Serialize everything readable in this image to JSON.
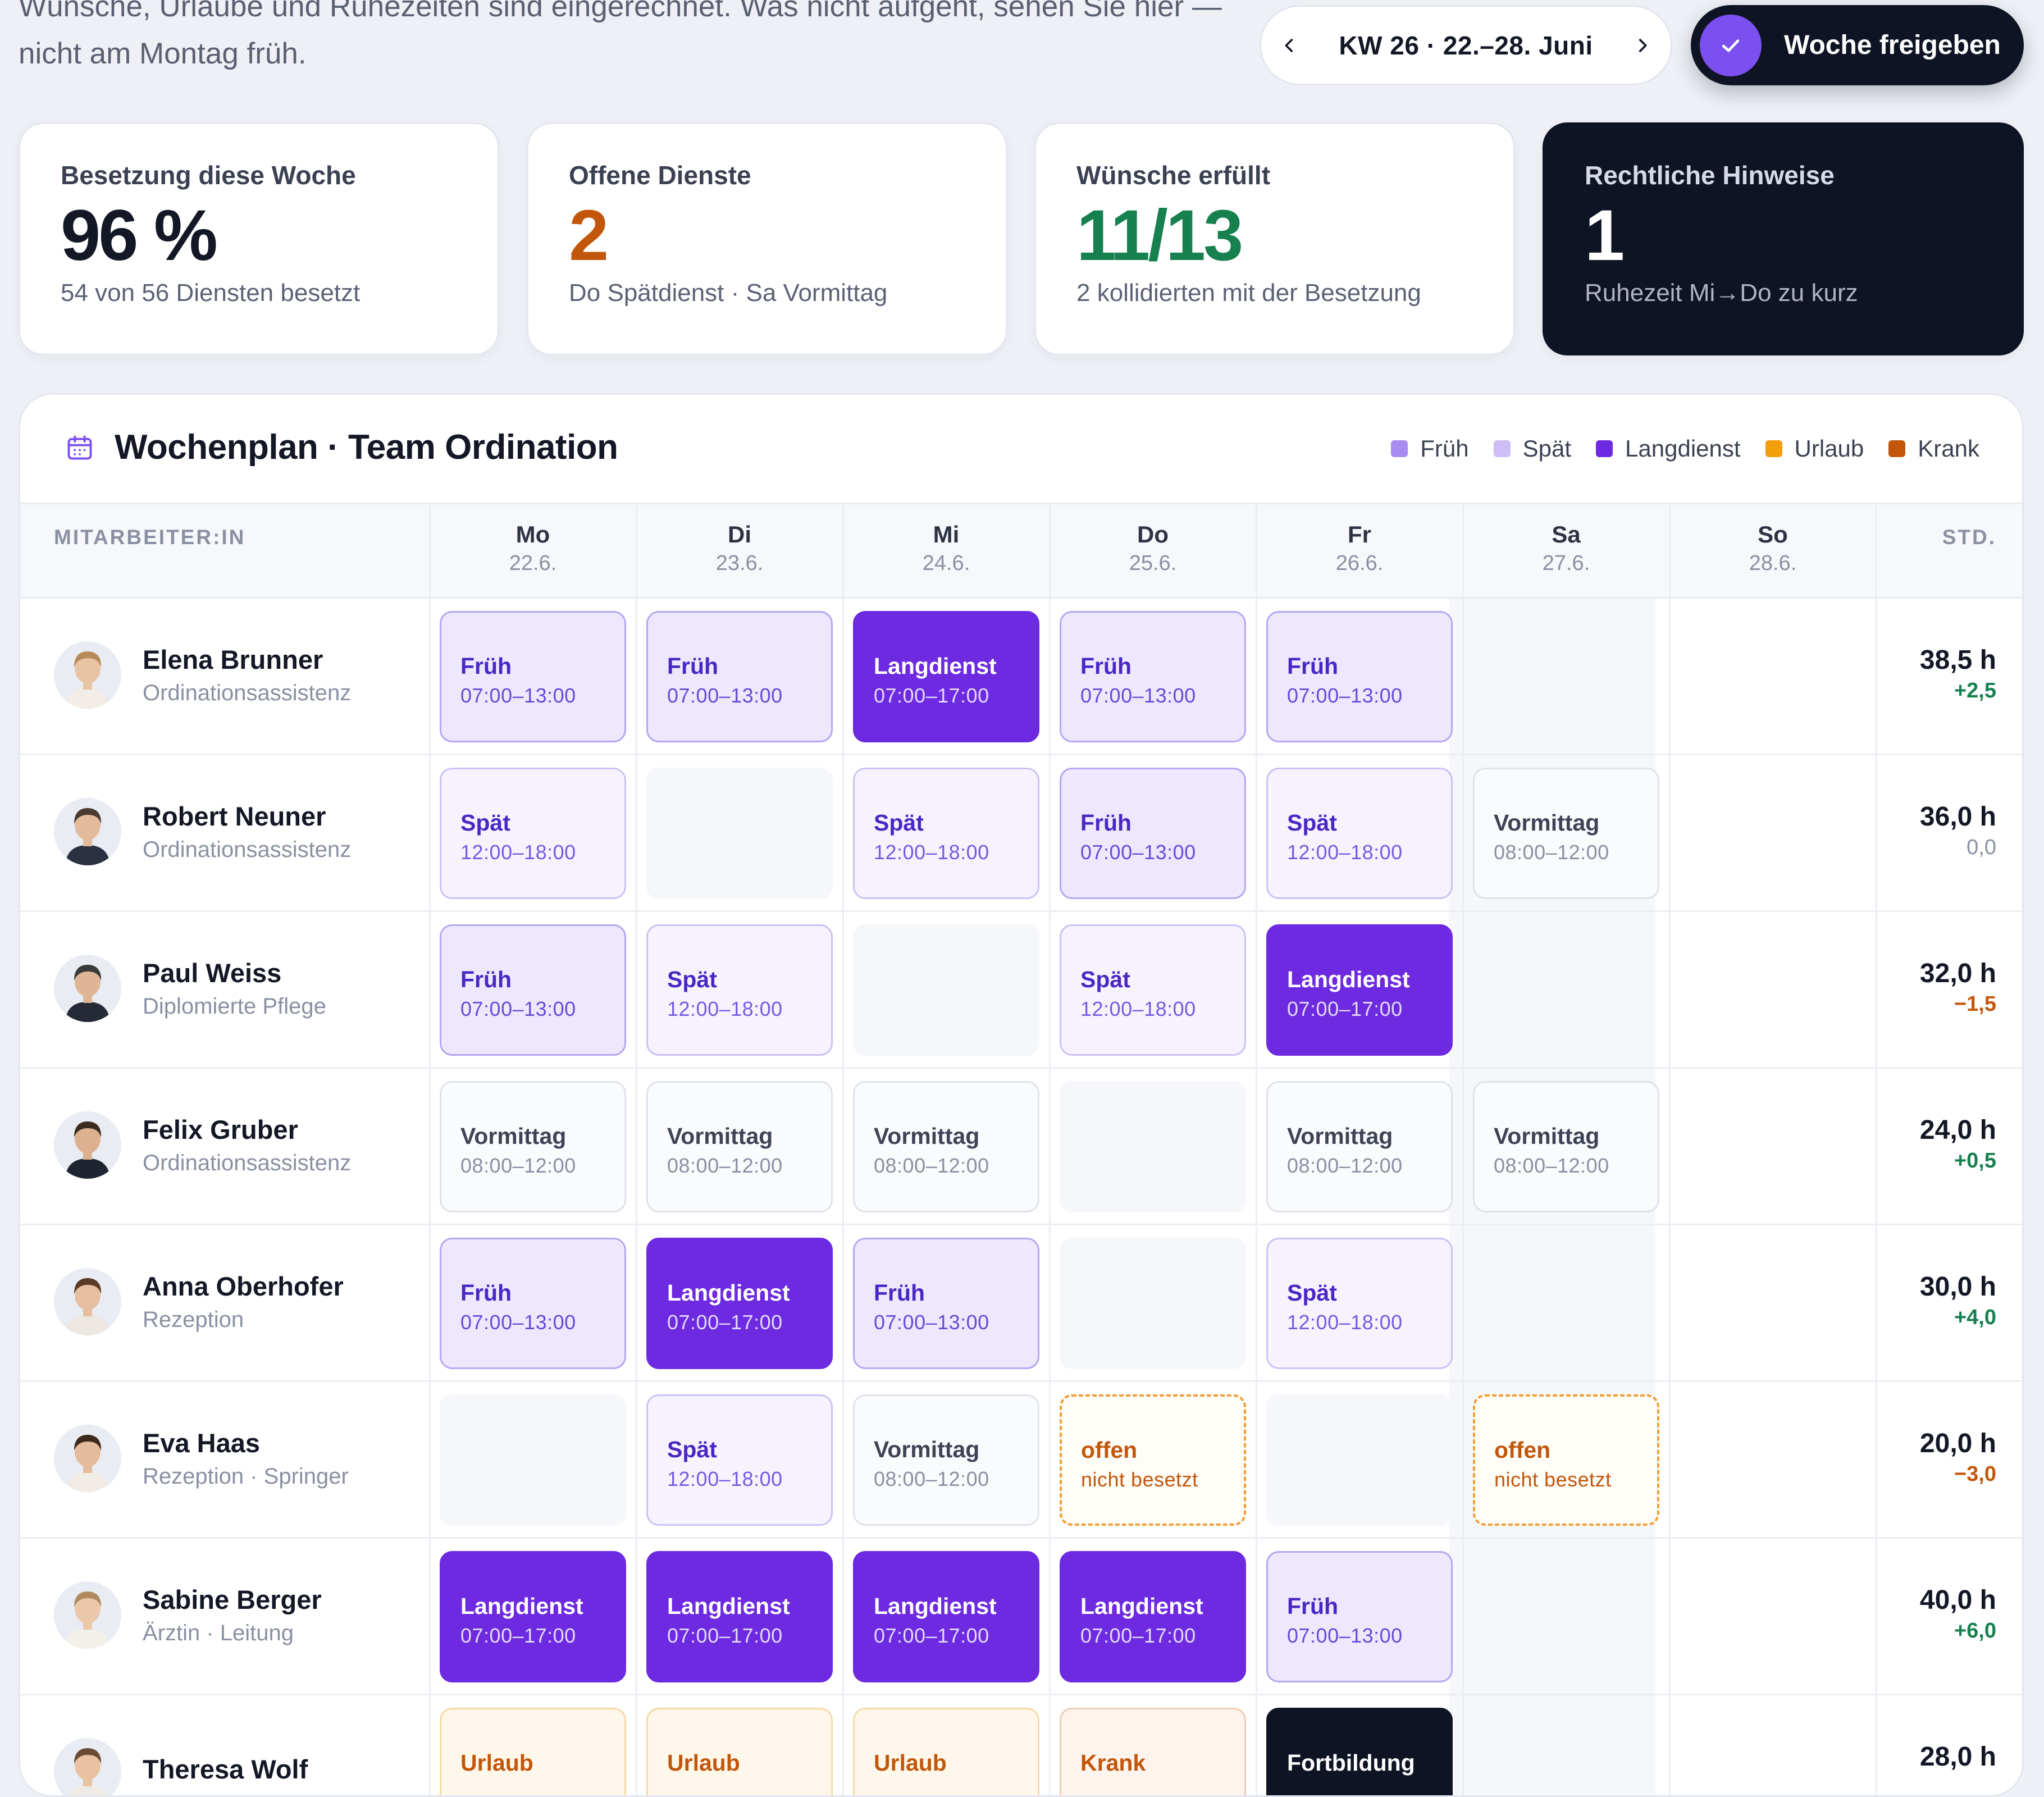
{
  "header": {
    "intro": "Wünsche, Urlaube und Ruhezeiten sind eingerechnet. Was nicht aufgeht, sehen Sie hier — nicht am Montag früh.",
    "week_label": "KW 26 · 22.–28. Juni",
    "release_label": "Woche freigeben"
  },
  "kpis": [
    {
      "label": "Besetzung diese Woche",
      "value": "96 %",
      "sub": "54 von 56 Diensten besetzt",
      "color": "#141826"
    },
    {
      "label": "Offene Dienste",
      "value": "2",
      "sub": "Do Spätdienst · Sa Vormittag",
      "color": "#c2570b"
    },
    {
      "label": "Wünsche erfüllt",
      "value": "11/13",
      "sub": "2 kollidierten mit der Besetzung",
      "color": "#17804f"
    },
    {
      "label": "Rechtliche Hinweise",
      "value": "1",
      "sub": "Ruhezeit Mi→Do zu kurz",
      "color": "#ffffff"
    }
  ],
  "plan": {
    "title": "Wochenplan · Team Ordination",
    "legend": [
      {
        "label": "Früh",
        "color": "#a98cf2"
      },
      {
        "label": "Spät",
        "color": "#cdbef8"
      },
      {
        "label": "Langdienst",
        "color": "#6d2ae0"
      },
      {
        "label": "Urlaub",
        "color": "#f59e0b"
      },
      {
        "label": "Krank",
        "color": "#c2570b"
      }
    ],
    "col_employee": "MITARBEITER:IN",
    "col_hours": "STD.",
    "days": [
      {
        "d": "Mo",
        "date": "22.6."
      },
      {
        "d": "Di",
        "date": "23.6."
      },
      {
        "d": "Mi",
        "date": "24.6."
      },
      {
        "d": "Do",
        "date": "25.6."
      },
      {
        "d": "Fr",
        "date": "26.6."
      },
      {
        "d": "Sa",
        "date": "27.6."
      },
      {
        "d": "So",
        "date": "28.6."
      }
    ],
    "employees": [
      {
        "name": "Elena Brunner",
        "role": "Ordinationsassistenz",
        "hours": "38,5 h",
        "delta": "+2,5",
        "trend": "pos",
        "avatar": {
          "skin": "#e9c4a4",
          "hair": "#b88a5a",
          "shirt": "#f2ede6"
        },
        "shifts": [
          [
            "frueh",
            "Früh",
            "07:00–13:00"
          ],
          [
            "frueh",
            "Früh",
            "07:00–13:00"
          ],
          [
            "lang",
            "Langdienst",
            "07:00–17:00"
          ],
          [
            "frueh",
            "Früh",
            "07:00–13:00"
          ],
          [
            "frueh",
            "Früh",
            "07:00–13:00"
          ],
          [
            "none",
            "",
            ""
          ],
          [
            "none",
            "",
            ""
          ]
        ]
      },
      {
        "name": "Robert Neuner",
        "role": "Ordinationsassistenz",
        "hours": "36,0 h",
        "delta": "0,0",
        "trend": "zero",
        "avatar": {
          "skin": "#e3bb9c",
          "hair": "#4a3a2f",
          "shirt": "#2b3140"
        },
        "shifts": [
          [
            "spaet",
            "Spät",
            "12:00–18:00"
          ],
          [
            "empty",
            "",
            ""
          ],
          [
            "spaet",
            "Spät",
            "12:00–18:00"
          ],
          [
            "frueh",
            "Früh",
            "07:00–13:00"
          ],
          [
            "spaet",
            "Spät",
            "12:00–18:00"
          ],
          [
            "vorm",
            "Vormittag",
            "08:00–12:00"
          ],
          [
            "none",
            "",
            ""
          ]
        ]
      },
      {
        "name": "Paul Weiss",
        "role": "Diplomierte Pflege",
        "hours": "32,0 h",
        "delta": "−1,5",
        "trend": "neg",
        "avatar": {
          "skin": "#e0b596",
          "hair": "#3a3a3a",
          "shirt": "#252a36"
        },
        "shifts": [
          [
            "frueh",
            "Früh",
            "07:00–13:00"
          ],
          [
            "spaet",
            "Spät",
            "12:00–18:00"
          ],
          [
            "empty",
            "",
            ""
          ],
          [
            "spaet",
            "Spät",
            "12:00–18:00"
          ],
          [
            "lang",
            "Langdienst",
            "07:00–17:00"
          ],
          [
            "none",
            "",
            ""
          ],
          [
            "none",
            "",
            ""
          ]
        ]
      },
      {
        "name": "Felix Gruber",
        "role": "Ordinationsassistenz",
        "hours": "24,0 h",
        "delta": "+0,5",
        "trend": "pos",
        "avatar": {
          "skin": "#ddb08f",
          "hair": "#3b2c22",
          "shirt": "#1f2430"
        },
        "shifts": [
          [
            "vorm",
            "Vormittag",
            "08:00–12:00"
          ],
          [
            "vorm",
            "Vormittag",
            "08:00–12:00"
          ],
          [
            "vorm",
            "Vormittag",
            "08:00–12:00"
          ],
          [
            "empty",
            "",
            ""
          ],
          [
            "vorm",
            "Vormittag",
            "08:00–12:00"
          ],
          [
            "vorm",
            "Vormittag",
            "08:00–12:00"
          ],
          [
            "none",
            "",
            ""
          ]
        ]
      },
      {
        "name": "Anna Oberhofer",
        "role": "Rezeption",
        "hours": "30,0 h",
        "delta": "+4,0",
        "trend": "pos",
        "avatar": {
          "skin": "#e6bfa0",
          "hair": "#5a3b28",
          "shirt": "#ece7e0"
        },
        "shifts": [
          [
            "frueh",
            "Früh",
            "07:00–13:00"
          ],
          [
            "lang",
            "Langdienst",
            "07:00–17:00"
          ],
          [
            "frueh",
            "Früh",
            "07:00–13:00"
          ],
          [
            "empty",
            "",
            ""
          ],
          [
            "spaet",
            "Spät",
            "12:00–18:00"
          ],
          [
            "none",
            "",
            ""
          ],
          [
            "none",
            "",
            ""
          ]
        ]
      },
      {
        "name": "Eva Haas",
        "role": "Rezeption · Springer",
        "hours": "20,0 h",
        "delta": "−3,0",
        "trend": "neg",
        "avatar": {
          "skin": "#e4bb9b",
          "hair": "#3d2a1e",
          "shirt": "#f1ece6"
        },
        "shifts": [
          [
            "empty",
            "",
            ""
          ],
          [
            "spaet",
            "Spät",
            "12:00–18:00"
          ],
          [
            "vorm",
            "Vormittag",
            "08:00–12:00"
          ],
          [
            "offen",
            "offen",
            "nicht besetzt"
          ],
          [
            "empty",
            "",
            ""
          ],
          [
            "offen",
            "offen",
            "nicht besetzt"
          ],
          [
            "none",
            "",
            ""
          ]
        ]
      },
      {
        "name": "Sabine Berger",
        "role": "Ärztin · Leitung",
        "hours": "40,0 h",
        "delta": "+6,0",
        "trend": "pos",
        "avatar": {
          "skin": "#ecc8aa",
          "hair": "#b08a5e",
          "shirt": "#f3efe9"
        },
        "shifts": [
          [
            "lang",
            "Langdienst",
            "07:00–17:00"
          ],
          [
            "lang",
            "Langdienst",
            "07:00–17:00"
          ],
          [
            "lang",
            "Langdienst",
            "07:00–17:00"
          ],
          [
            "lang",
            "Langdienst",
            "07:00–17:00"
          ],
          [
            "frueh",
            "Früh",
            "07:00–13:00"
          ],
          [
            "none",
            "",
            ""
          ],
          [
            "none",
            "",
            ""
          ]
        ]
      },
      {
        "name": "Theresa Wolf",
        "role": "",
        "hours": "28,0 h",
        "delta": "",
        "trend": "pos",
        "avatar": {
          "skin": "#e8c2a3",
          "hair": "#6a4a32",
          "shirt": "#f0ebe5"
        },
        "shifts": [
          [
            "urlaub",
            "Urlaub",
            ""
          ],
          [
            "urlaub",
            "Urlaub",
            ""
          ],
          [
            "urlaub",
            "Urlaub",
            ""
          ],
          [
            "krank",
            "Krank",
            ""
          ],
          [
            "fort",
            "Fortbildung",
            ""
          ],
          [
            "none",
            "",
            ""
          ],
          [
            "none",
            "",
            ""
          ]
        ]
      }
    ]
  }
}
